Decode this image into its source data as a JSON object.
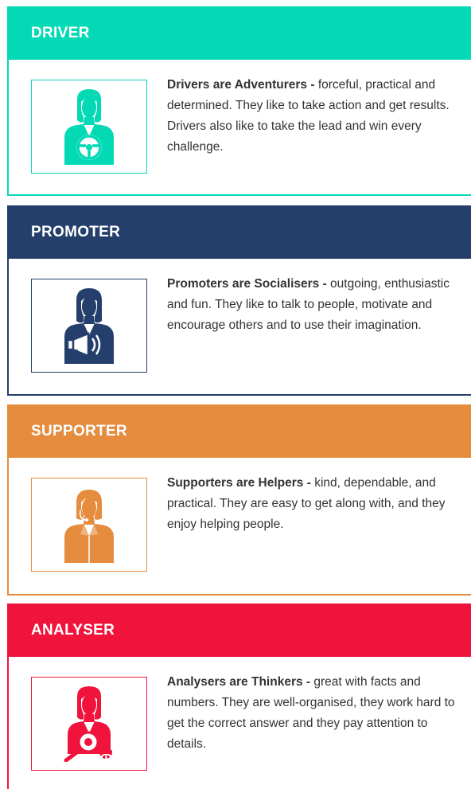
{
  "colors": {
    "driver": "#04d9b6",
    "promoter": "#243f6b",
    "supporter": "#e58c3f",
    "analyser": "#f0143c"
  },
  "cards": [
    {
      "title": "DRIVER",
      "icon": "steering-wheel-person-icon",
      "lead": "Drivers are Adventurers -",
      "text": " forceful, practical and determined. They like to take action and get results. Drivers also like to take the lead and win every challenge."
    },
    {
      "title": "PROMOTER",
      "icon": "megaphone-person-icon",
      "lead": "Promoters are Socialisers -",
      "text": " outgoing, enthusiastic and fun. They like to talk to people, motivate and encourage others and to use their imagination."
    },
    {
      "title": "SUPPORTER",
      "icon": "headset-person-icon",
      "lead": "Supporters are Helpers -",
      "text": " kind, dependable, and practical. They are easy to get along with, and they enjoy helping people."
    },
    {
      "title": "ANALYSER",
      "icon": "magnifier-gear-person-icon",
      "lead": "Analysers are Thinkers -",
      "text": " great with facts and numbers. They are well-organised, they work hard to get the correct answer and they pay attention to details."
    }
  ]
}
